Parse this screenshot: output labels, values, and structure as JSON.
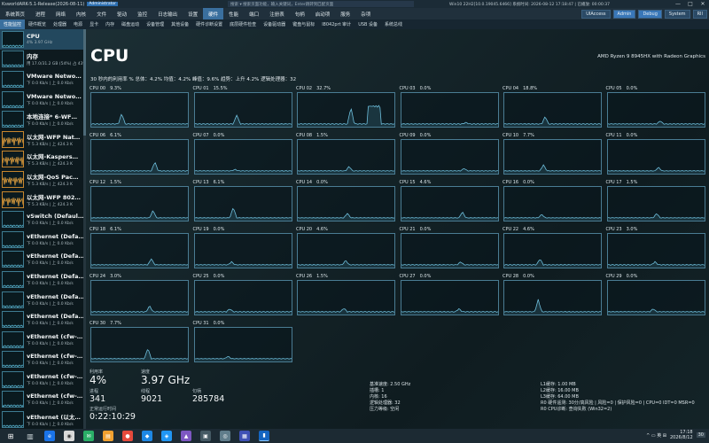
{
  "titlebar": {
    "app_title": "KsworldARK-5.1-Release(2026-08-11)",
    "badge": "Administrator",
    "search_placeholder": "搜索 ▾  搜索页面功能，输入关键词，Enter跳转到匹配页面",
    "sysinfo": "Win10 22H2[10.0.19045.6466]   系统时间: 2026-08-12 17:18:47 | 已播放: 00:00:37",
    "min": "—",
    "max": "□",
    "close": "✕"
  },
  "menu": {
    "items": [
      "系统首页",
      "进程",
      "网络",
      "内核",
      "文件",
      "驱动",
      "监控",
      "日志输出",
      "设置",
      "硬件",
      "性能",
      "端口",
      "注册表",
      "句柄",
      "启动项",
      "服务",
      "杂项"
    ],
    "active_index": 9,
    "uiaccess": "UIAccess",
    "admin": "Admin",
    "debug": "Debug",
    "system": "System",
    "rl": "RII"
  },
  "subtabs": {
    "items": [
      "性能监控",
      "硬件概览",
      "处理器",
      "电源",
      "显卡",
      "内存",
      "磁盘运动",
      "设备管理",
      "其他设备",
      "硬件诊断设置",
      "底层硬件检查",
      "设备驱动器",
      "键盘与鼠标",
      "I8042prt 审计",
      "USB 设备",
      "系统总线"
    ],
    "active_index": 0
  },
  "devices": [
    {
      "name": "CPU",
      "sub": "4%  3.97 GHz",
      "orange": false,
      "selected": true
    },
    {
      "name": "内存",
      "sub": "用 17.0/31.2 GB (54%)  占 43%",
      "orange": false,
      "selected": false
    },
    {
      "name": "VMware Netwo…",
      "sub": "下 0.0 Kb/s | 上 0.0 Kb/s",
      "orange": false,
      "selected": false
    },
    {
      "name": "VMware Netwo…",
      "sub": "下 0.0 Kb/s | 上 0.0 Kb/s",
      "orange": false,
      "selected": false
    },
    {
      "name": "本地连接* 6-WF…",
      "sub": "下 0.0 Kb/s | 上 0.0 Kb/s",
      "orange": false,
      "selected": false
    },
    {
      "name": "以太网-WFP Nat…",
      "sub": "下 5.3 KB/s | 上 424.3 K",
      "orange": true,
      "selected": false
    },
    {
      "name": "以太网-Kaspers…",
      "sub": "下 5.3 KB/s | 上 424.3 K",
      "orange": true,
      "selected": false
    },
    {
      "name": "以太网-QoS Pac…",
      "sub": "下 5.3 KB/s | 上 424.3 K",
      "orange": true,
      "selected": false
    },
    {
      "name": "以太网-WFP 802…",
      "sub": "下 5.3 KB/s | 上 424.3 K",
      "orange": true,
      "selected": false
    },
    {
      "name": "vSwitch (Defaul…",
      "sub": "下 0.0 Kb/s | 上 0.0 Kb/s",
      "orange": false,
      "selected": false
    },
    {
      "name": "vEthernet (Defa…",
      "sub": "下 0.0 Kb/s | 上 0.0 Kb/s",
      "orange": false,
      "selected": false
    },
    {
      "name": "vEthernet (Defa…",
      "sub": "下 0.0 Kb/s | 上 0.0 Kb/s",
      "orange": false,
      "selected": false
    },
    {
      "name": "vEthernet (Defa…",
      "sub": "下 0.0 Kb/s | 上 0.0 Kb/s",
      "orange": false,
      "selected": false
    },
    {
      "name": "vEthernet (Defa…",
      "sub": "下 0.0 Kb/s | 上 0.0 Kb/s",
      "orange": false,
      "selected": false
    },
    {
      "name": "vEthernet (Defa…",
      "sub": "下 0.0 Kb/s | 上 0.0 Kb/s",
      "orange": false,
      "selected": false
    },
    {
      "name": "vEthernet (cfw-…",
      "sub": "下 0.0 Kb/s | 上 0.0 Kb/s",
      "orange": false,
      "selected": false
    },
    {
      "name": "vEthernet (cfw-…",
      "sub": "下 0.0 Kb/s | 上 0.0 Kb/s",
      "orange": false,
      "selected": false
    },
    {
      "name": "vEthernet (cfw-…",
      "sub": "下 0.0 Kb/s | 上 0.0 Kb/s",
      "orange": false,
      "selected": false
    },
    {
      "name": "vEthernet (cfw-…",
      "sub": "下 0.0 Kb/s | 上 0.0 Kb/s",
      "orange": false,
      "selected": false
    },
    {
      "name": "vEthernet (以太…",
      "sub": "下 0.0 Kb/s | 上 0.0 Kb/s",
      "orange": false,
      "selected": false
    }
  ],
  "main": {
    "title": "CPU",
    "model": "AMD Ryzen 9 8945HX with Radeon Graphics",
    "stats": "30 秒内的利用率 %   总体：4.2%   均值：4.2%   峰值：9.6%   趋势：上升 4.2%   逻辑处理器：32"
  },
  "cores": [
    {
      "label": "CPU 00",
      "pct": "9.3%",
      "spike": 0.35
    },
    {
      "label": "CPU 01",
      "pct": "15.5%",
      "spike": 0.3
    },
    {
      "label": "CPU 02",
      "pct": "32.7%",
      "spike": 0.55
    },
    {
      "label": "CPU 03",
      "pct": "0.0%",
      "spike": 0.05
    },
    {
      "label": "CPU 04",
      "pct": "18.8%",
      "spike": 0.25
    },
    {
      "label": "CPU 05",
      "pct": "0.0%",
      "spike": 0.1
    },
    {
      "label": "CPU 06",
      "pct": "6.1%",
      "spike": 0.3
    },
    {
      "label": "CPU 07",
      "pct": "0.0%",
      "spike": 0.05
    },
    {
      "label": "CPU 08",
      "pct": "1.5%",
      "spike": 0.15
    },
    {
      "label": "CPU 09",
      "pct": "0.0%",
      "spike": 0.08
    },
    {
      "label": "CPU 10",
      "pct": "7.7%",
      "spike": 0.2
    },
    {
      "label": "CPU 11",
      "pct": "0.0%",
      "spike": 0.12
    },
    {
      "label": "CPU 12",
      "pct": "1.5%",
      "spike": 0.25
    },
    {
      "label": "CPU 13",
      "pct": "6.1%",
      "spike": 0.35
    },
    {
      "label": "CPU 14",
      "pct": "0.0%",
      "spike": 0.15
    },
    {
      "label": "CPU 15",
      "pct": "4.6%",
      "spike": 0.2
    },
    {
      "label": "CPU 16",
      "pct": "0.0%",
      "spike": 0.12
    },
    {
      "label": "CPU 17",
      "pct": "1.5%",
      "spike": 0.15
    },
    {
      "label": "CPU 18",
      "pct": "6.1%",
      "spike": 0.2
    },
    {
      "label": "CPU 19",
      "pct": "0.0%",
      "spike": 0.1
    },
    {
      "label": "CPU 20",
      "pct": "4.6%",
      "spike": 0.15
    },
    {
      "label": "CPU 21",
      "pct": "0.0%",
      "spike": 0.1
    },
    {
      "label": "CPU 22",
      "pct": "4.6%",
      "spike": 0.2
    },
    {
      "label": "CPU 23",
      "pct": "3.0%",
      "spike": 0.1
    },
    {
      "label": "CPU 24",
      "pct": "3.0%",
      "spike": 0.2
    },
    {
      "label": "CPU 25",
      "pct": "0.0%",
      "spike": 0.1
    },
    {
      "label": "CPU 26",
      "pct": "1.5%",
      "spike": 0.12
    },
    {
      "label": "CPU 27",
      "pct": "0.0%",
      "spike": 0.1
    },
    {
      "label": "CPU 28",
      "pct": "0.0%",
      "spike": 0.4
    },
    {
      "label": "CPU 29",
      "pct": "0.0%",
      "spike": 0.1
    },
    {
      "label": "CPU 30",
      "pct": "7.7%",
      "spike": 0.35
    },
    {
      "label": "CPU 31",
      "pct": "0.0%",
      "spike": 0.08
    }
  ],
  "bottom": {
    "util_label": "利用率",
    "util": "4%",
    "speed_label": "速度",
    "speed": "3.97 GHz",
    "proc_label": "进程",
    "proc": "341",
    "thread_label": "线程",
    "thread": "9021",
    "handle_label": "句柄",
    "handle": "285784",
    "uptime_label": "正常运行时间",
    "uptime": "0:22:10:29",
    "mid": [
      "基准速度: 2.50 GHz",
      "插槽: 1",
      "内核: 16",
      "逻辑处理器: 32",
      "压力等级: 空闲"
    ],
    "right": [
      "L1缓存: 1.00 MB",
      "L2缓存: 16.00 MB",
      "L3缓存: 64.00 MB",
      "R0 硬件遥测: 30分/高风险 | 风险=0 | 保护风险=0 | CPU=0 IDT=0 MSR=0",
      "R0 CPU诊断: 查询失败 (Win32=2)"
    ]
  },
  "taskbar": {
    "tray": "^ ▭ 英 ⊞",
    "time": "17:18",
    "date": "2026/8/12",
    "notify": "30"
  }
}
